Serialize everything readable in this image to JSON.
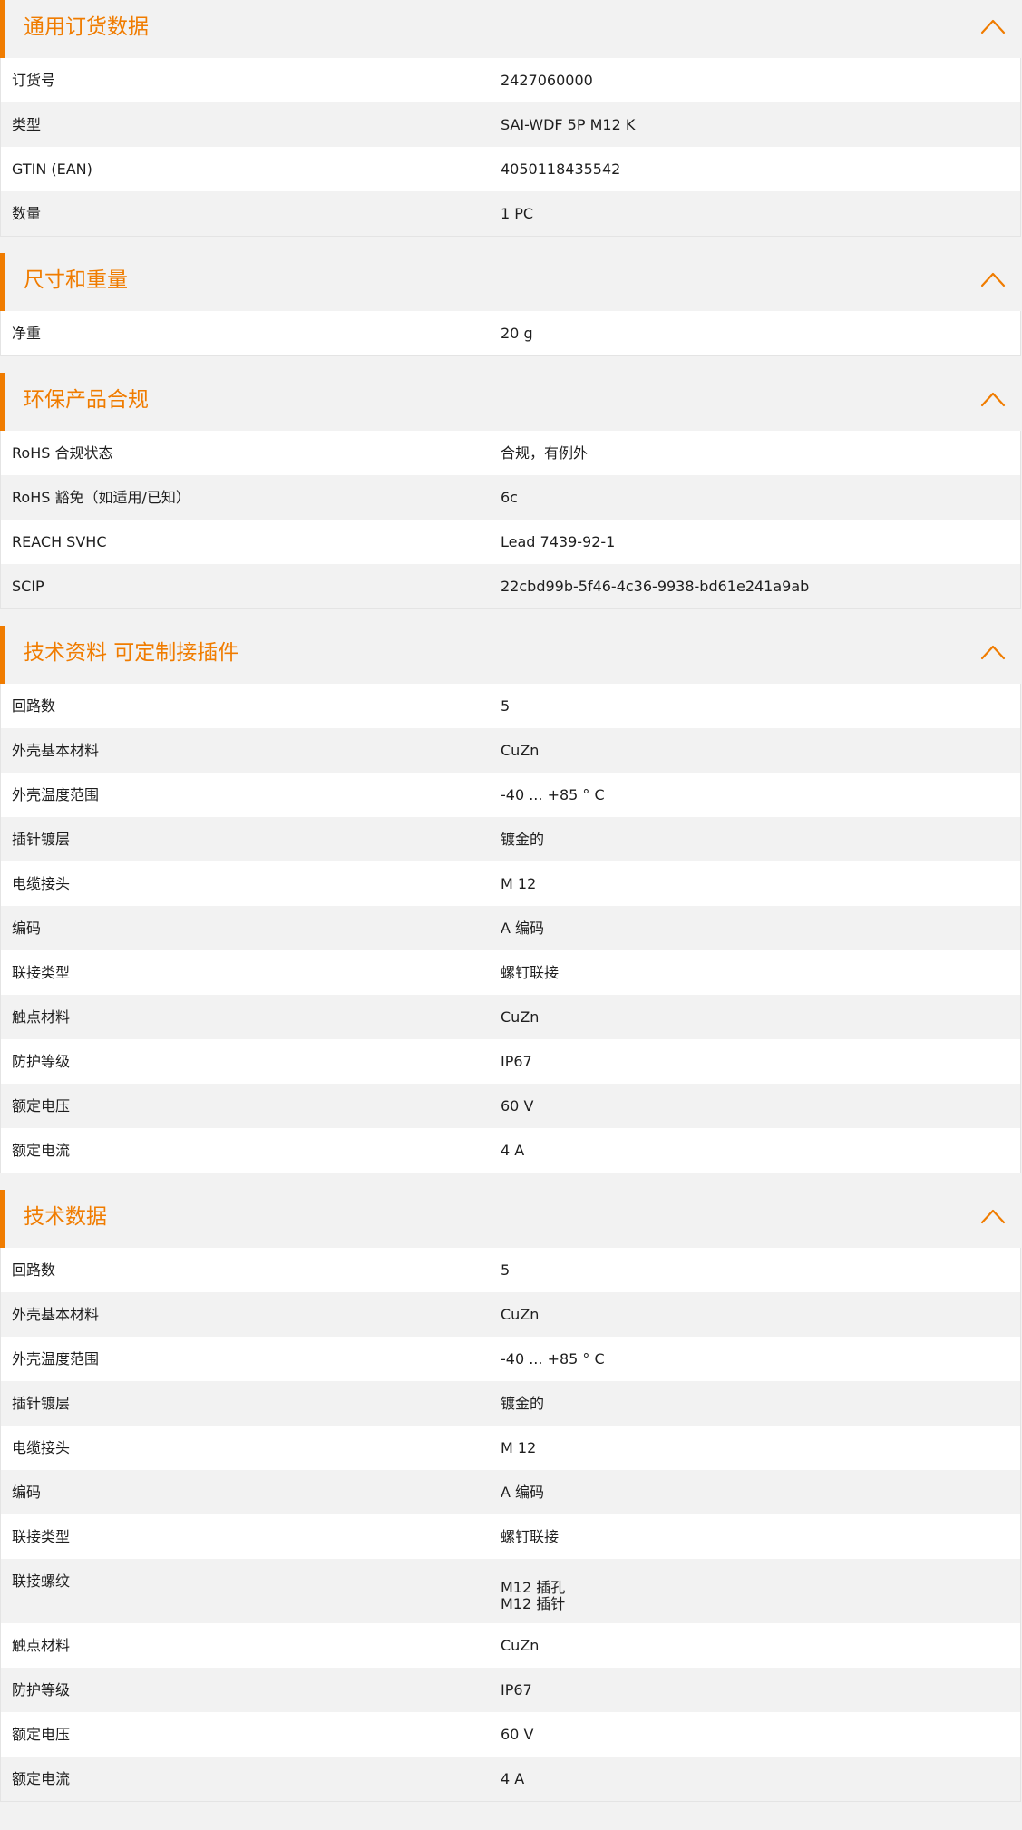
{
  "accent_color": "#f07c00",
  "sections": [
    {
      "title": "通用订货数据",
      "chevron_icon": "chevron-up-icon",
      "rows": [
        {
          "label": "订货号",
          "value": "2427060000"
        },
        {
          "label": "类型",
          "value": "SAI-WDF 5P M12 K"
        },
        {
          "label": "GTIN (EAN)",
          "value": "4050118435542"
        },
        {
          "label": "数量",
          "value": "1  PC"
        }
      ]
    },
    {
      "title": "尺寸和重量",
      "chevron_icon": "chevron-up-icon",
      "rows": [
        {
          "label": "净重",
          "value": "20  g"
        }
      ]
    },
    {
      "title": "环保产品合规",
      "chevron_icon": "chevron-up-icon",
      "rows": [
        {
          "label": "RoHS 合规状态",
          "value": "合规，有例外"
        },
        {
          "label": "RoHS 豁免（如适用/已知）",
          "value": "6c"
        },
        {
          "label": "REACH SVHC",
          "value": "Lead 7439-92-1"
        },
        {
          "label": "SCIP",
          "value": "22cbd99b-5f46-4c36-9938-bd61e241a9ab"
        }
      ]
    },
    {
      "title": "技术资料 可定制接插件",
      "chevron_icon": "chevron-up-icon",
      "rows": [
        {
          "label": "回路数",
          "value": "5"
        },
        {
          "label": "外壳基本材料",
          "value": "CuZn"
        },
        {
          "label": "外壳温度范围",
          "value": "-40 ... +85 ° C"
        },
        {
          "label": "插针镀层",
          "value": "镀金的"
        },
        {
          "label": "电缆接头",
          "value": "M 12"
        },
        {
          "label": "编码",
          "value": "A 编码"
        },
        {
          "label": "联接类型",
          "value": "螺钉联接"
        },
        {
          "label": "触点材料",
          "value": "CuZn"
        },
        {
          "label": "防护等级",
          "value": "IP67"
        },
        {
          "label": "额定电压",
          "value": "60  V"
        },
        {
          "label": "额定电流",
          "value": "4  A"
        }
      ]
    },
    {
      "title": "技术数据",
      "chevron_icon": "chevron-up-icon",
      "rows": [
        {
          "label": "回路数",
          "value": "5"
        },
        {
          "label": "外壳基本材料",
          "value": "CuZn"
        },
        {
          "label": "外壳温度范围",
          "value": "-40 ... +85 ° C"
        },
        {
          "label": "插针镀层",
          "value": "镀金的"
        },
        {
          "label": "电缆接头",
          "value": "M 12"
        },
        {
          "label": "编码",
          "value": "A 编码"
        },
        {
          "label": "联接类型",
          "value": "螺钉联接"
        },
        {
          "label": "联接螺纹",
          "value": "M12 插孔\nM12 插针"
        },
        {
          "label": "触点材料",
          "value": "CuZn"
        },
        {
          "label": "防护等级",
          "value": "IP67"
        },
        {
          "label": "额定电压",
          "value": "60  V"
        },
        {
          "label": "额定电流",
          "value": "4  A"
        }
      ]
    }
  ]
}
